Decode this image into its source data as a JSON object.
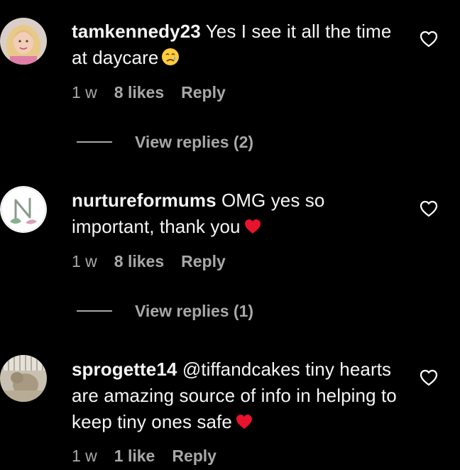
{
  "comments": [
    {
      "username": "tamkennedy23",
      "text": "Yes I see it all the time at daycare",
      "emoji": "crying-face-emoji",
      "time": "1 w",
      "likes": "8 likes",
      "reply": "Reply",
      "view_replies": "View replies (2)"
    },
    {
      "username": "nurtureformums",
      "text": "OMG yes so important, thank you",
      "emoji": "red-heart-emoji",
      "time": "1 w",
      "likes": "8 likes",
      "reply": "Reply",
      "view_replies": "View replies (1)"
    },
    {
      "username": "sprogette14",
      "text": "@tiffandcakes tiny hearts are amazing source of info in helping to keep tiny ones safe",
      "emoji": "red-heart-emoji",
      "time": "1 w",
      "likes": "1 like",
      "reply": "Reply"
    }
  ],
  "colors": {
    "background": "#000000",
    "text": "#f5f5f5",
    "secondary": "#a8a8a8",
    "heart_emoji": "#e8132d"
  }
}
